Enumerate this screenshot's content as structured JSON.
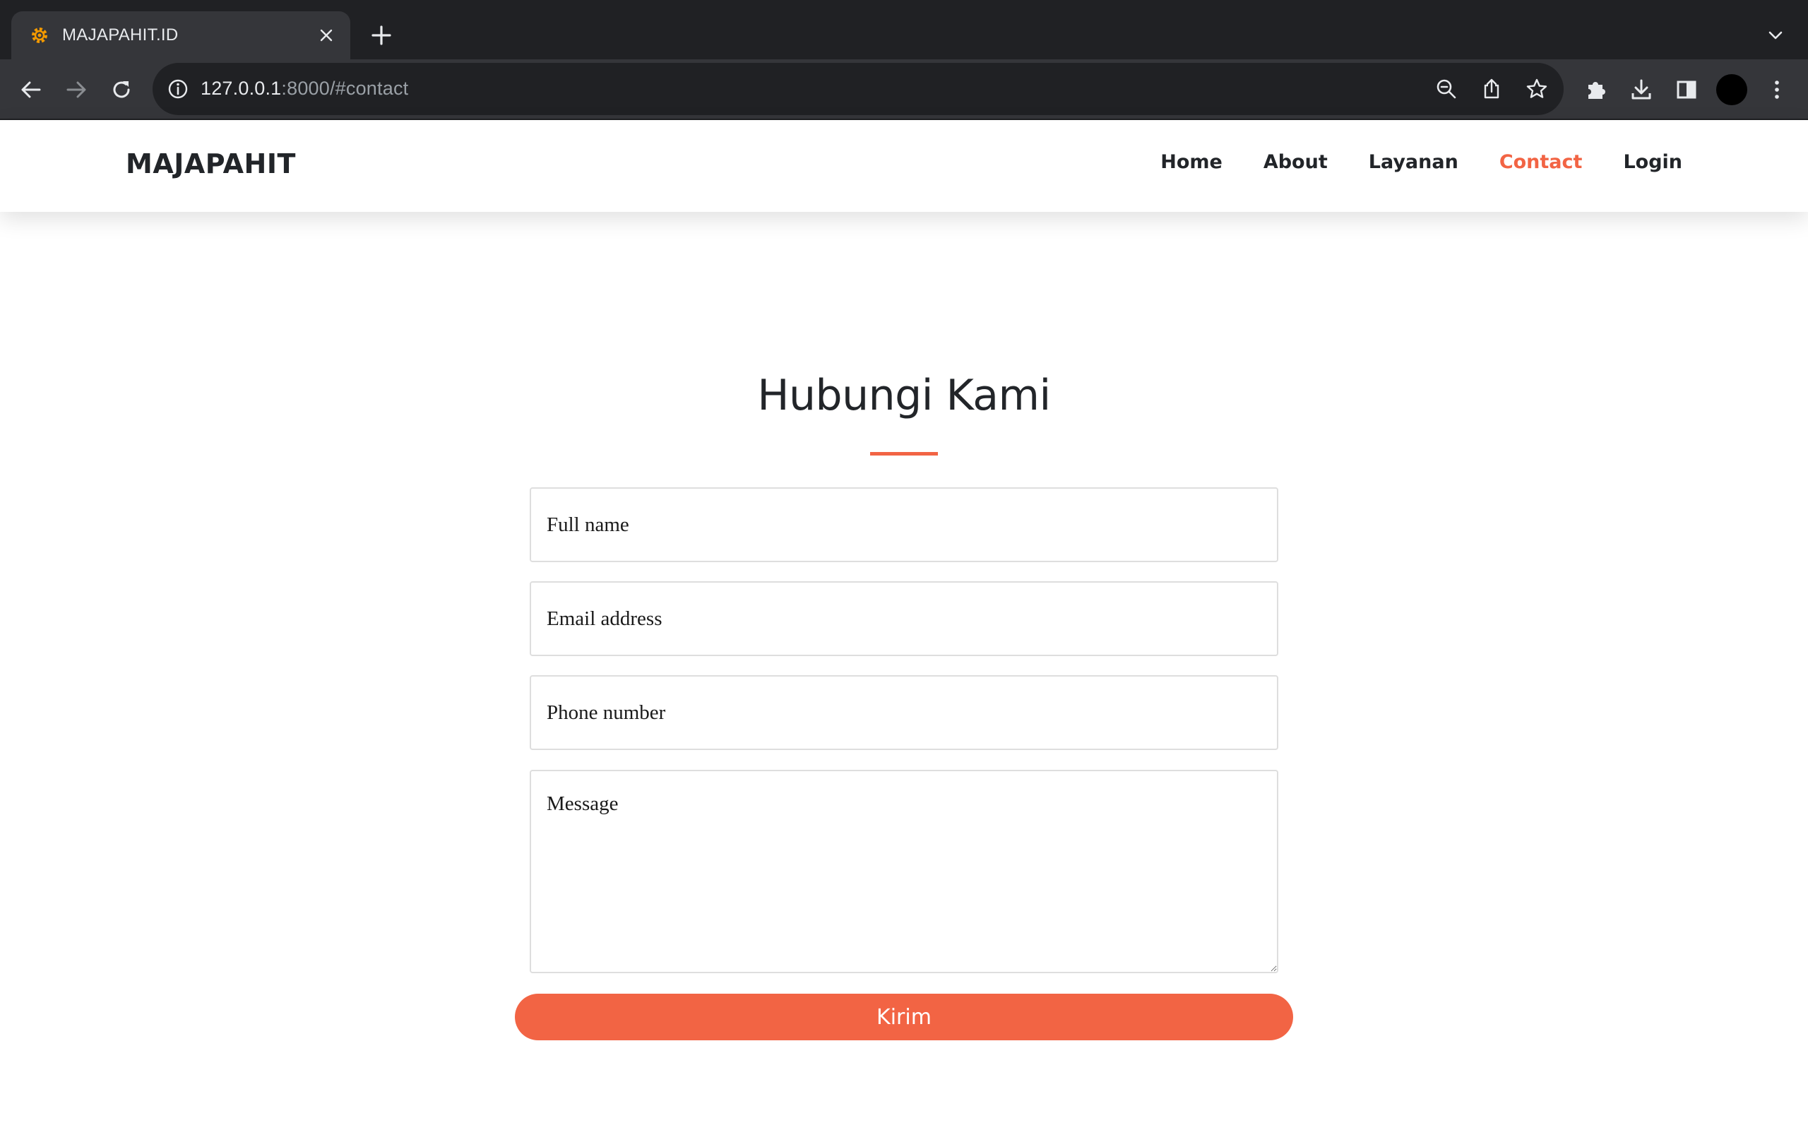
{
  "browser": {
    "tab_title": "MAJAPAHIT.ID",
    "url_host": "127.0.0.1",
    "url_rest": ":8000/#contact"
  },
  "site": {
    "brand": "MAJAPAHIT",
    "nav": [
      {
        "label": "Home"
      },
      {
        "label": "About"
      },
      {
        "label": "Layanan"
      },
      {
        "label": "Contact",
        "active": true
      },
      {
        "label": "Login"
      }
    ]
  },
  "contact": {
    "heading": "Hubungi Kami",
    "fullname_placeholder": "Full name",
    "email_placeholder": "Email address",
    "phone_placeholder": "Phone number",
    "message_placeholder": "Message",
    "submit_label": "Kirim"
  },
  "colors": {
    "accent": "#f26444",
    "text": "#222529",
    "chrome_dark": "#202124",
    "chrome_toolbar": "#35363a"
  }
}
